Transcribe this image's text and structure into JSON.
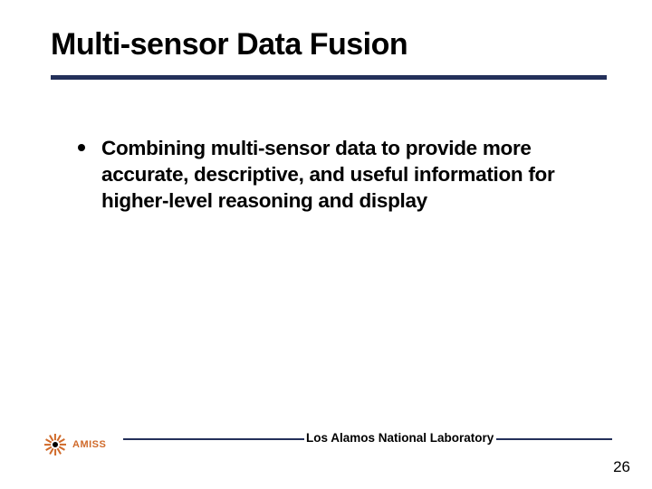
{
  "title": "Multi-sensor Data Fusion",
  "bullets": [
    {
      "text": "Combining multi-sensor data to provide more accurate, descriptive, and useful information for higher-level reasoning and display"
    }
  ],
  "footer": {
    "label": "Los Alamos National Laboratory",
    "logo_text": "AMISS"
  },
  "page_number": "26",
  "colors": {
    "rule": "#23305a",
    "accent": "#d06a2a"
  }
}
